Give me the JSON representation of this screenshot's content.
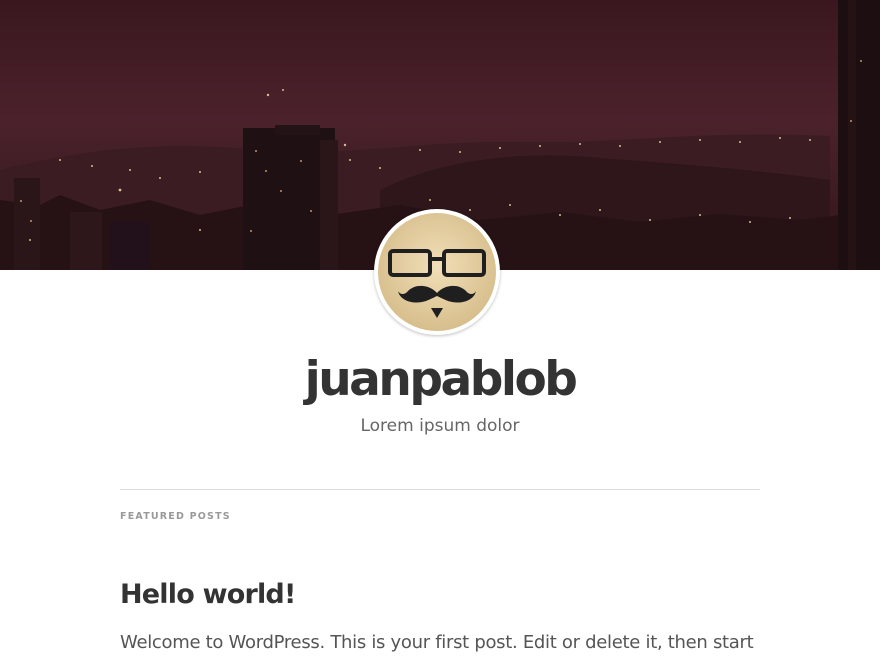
{
  "site": {
    "title": "juanpablob",
    "description": "Lorem ipsum dolor",
    "header_image": "night-city-skyline-image",
    "avatar": "mustache-glasses-avatar-image"
  },
  "featured": {
    "section_label": "FEATURED POSTS",
    "posts": [
      {
        "title": "Hello world!",
        "excerpt": "Welcome to WordPress. This is your first post. Edit or delete it, then start"
      }
    ]
  },
  "colors": {
    "title": "#333333",
    "description": "#666666",
    "label": "#999999",
    "divider": "#dddddd",
    "banner": "#4a2029"
  }
}
